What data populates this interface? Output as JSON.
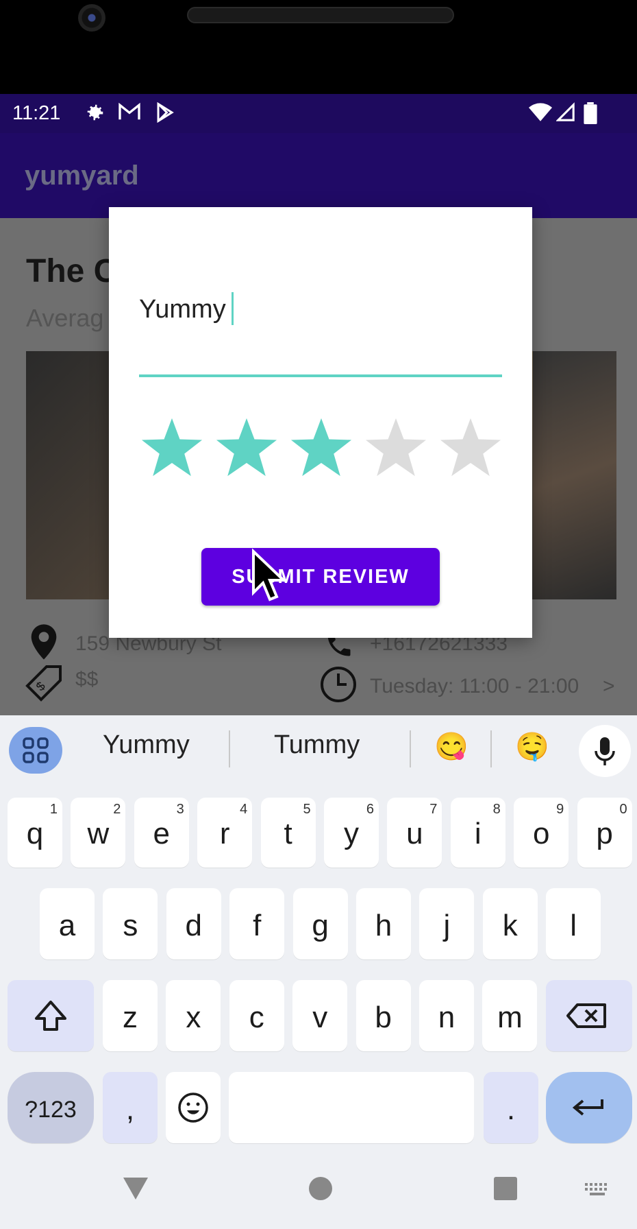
{
  "status_bar": {
    "time": "11:21",
    "icons_left": [
      "settings-icon",
      "gmail-icon",
      "play-store-icon"
    ],
    "icons_right": [
      "wifi-icon",
      "signal-icon",
      "battery-icon"
    ]
  },
  "app_bar": {
    "title": "yumyard"
  },
  "restaurant": {
    "name_visible": "The C",
    "avg_visible": "Averag",
    "address": "159 Newbury St",
    "price": "$$",
    "phone": "+16172621333",
    "hours": "Tuesday: 11:00 - 21:00",
    "hours_chevron": ">"
  },
  "dialog": {
    "review_text": "Yummy",
    "rating": 3,
    "max_rating": 5,
    "submit_label": "SUBMIT REVIEW",
    "colors": {
      "accent": "#5fd3c4",
      "star_empty": "#dcdcdc",
      "button": "#5d00e0"
    }
  },
  "keyboard": {
    "suggestions": [
      "Yummy",
      "Tummy"
    ],
    "emoji_suggestions": [
      "😋",
      "🤤"
    ],
    "row1": [
      {
        "k": "q",
        "n": "1"
      },
      {
        "k": "w",
        "n": "2"
      },
      {
        "k": "e",
        "n": "3"
      },
      {
        "k": "r",
        "n": "4"
      },
      {
        "k": "t",
        "n": "5"
      },
      {
        "k": "y",
        "n": "6"
      },
      {
        "k": "u",
        "n": "7"
      },
      {
        "k": "i",
        "n": "8"
      },
      {
        "k": "o",
        "n": "9"
      },
      {
        "k": "p",
        "n": "0"
      }
    ],
    "row2": [
      "a",
      "s",
      "d",
      "f",
      "g",
      "h",
      "j",
      "k",
      "l"
    ],
    "row3": [
      "z",
      "x",
      "c",
      "v",
      "b",
      "n",
      "m"
    ],
    "sym_label": "?123",
    "comma": ",",
    "period": "."
  },
  "nav_bar": {
    "icons": [
      "back-icon",
      "home-icon",
      "recents-icon",
      "keyboard-switch-icon"
    ]
  }
}
